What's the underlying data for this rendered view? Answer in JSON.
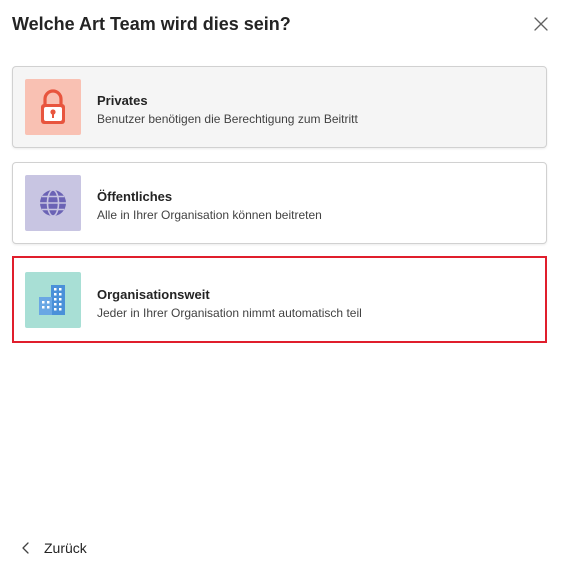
{
  "dialog": {
    "title": "Welche Art Team wird dies sein?",
    "close_icon": "close-icon"
  },
  "options": [
    {
      "title": "Privates",
      "description": "Benutzer benötigen die Berechtigung zum Beitritt",
      "icon": "lock-icon",
      "tile_color": "#f9c1b3",
      "icon_color": "#e8553e",
      "state": "hovered"
    },
    {
      "title": "Öffentliches",
      "description": "Alle in Ihrer Organisation können beitreten",
      "icon": "globe-icon",
      "tile_color": "#c8c5e2",
      "icon_color": "#6b63b5",
      "state": "default"
    },
    {
      "title": "Organisationsweit",
      "description": "Jeder in Ihrer Organisation nimmt automatisch teil",
      "icon": "building-icon",
      "tile_color": "#a8dfd5",
      "icon_color": "#4a90d9",
      "state": "selected"
    }
  ],
  "footer": {
    "back_label": "Zurück",
    "back_icon": "chevron-left-icon"
  },
  "colors": {
    "selection_border": "#e01e2c",
    "hover_background": "#f5f5f5"
  }
}
